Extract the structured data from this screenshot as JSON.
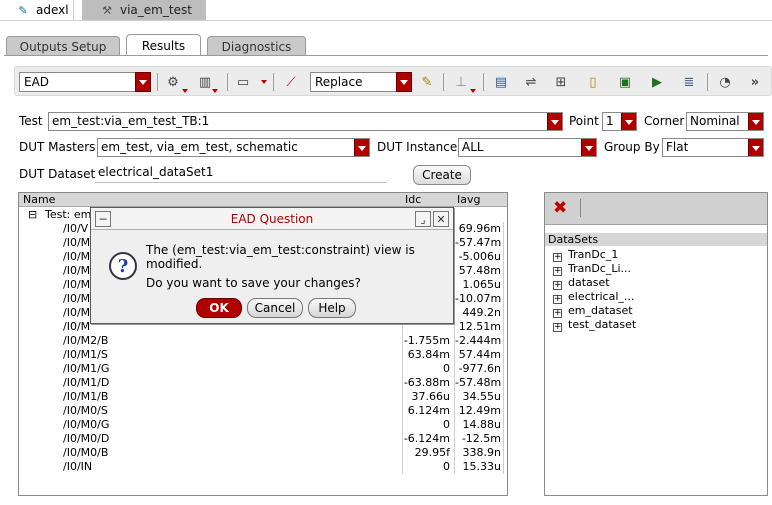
{
  "window_tabs": [
    {
      "label": "adexl",
      "icon": "pencil-icon"
    },
    {
      "label": "via_em_test",
      "icon": "schematic-icon"
    }
  ],
  "sub_tabs": [
    "Outputs Setup",
    "Results",
    "Diagnostics"
  ],
  "toolbar": {
    "view_select": "EAD",
    "mode_select": "Replace"
  },
  "form": {
    "test_label": "Test",
    "test_value": "em_test:via_em_test_TB:1",
    "point_label": "Point",
    "point_value": "1",
    "corner_label": "Corner",
    "corner_value": "Nominal",
    "dut_masters_label": "DUT Masters",
    "dut_masters_value": "em_test, via_em_test, schematic",
    "dut_instance_label": "DUT Instance",
    "dut_instance_value": "ALL",
    "group_by_label": "Group By",
    "group_by_value": "Flat",
    "dut_dataset_label": "DUT Dataset",
    "dut_dataset_value": "electrical_dataSet1",
    "create_button": "Create"
  },
  "table": {
    "headers": [
      "Name",
      "Idc",
      "Iavg"
    ],
    "group_label": "Test: em",
    "group_toggle": "⊟",
    "rows": [
      {
        "name": "/I0/V",
        "idc": "",
        "iavg": "69.96m"
      },
      {
        "name": "/I0/M",
        "idc": "",
        "iavg": "-57.47m"
      },
      {
        "name": "/I0/M",
        "idc": "",
        "iavg": "-5.006u"
      },
      {
        "name": "/I0/M",
        "idc": "",
        "iavg": "57.48m"
      },
      {
        "name": "/I0/M",
        "idc": "",
        "iavg": "1.065u"
      },
      {
        "name": "/I0/M",
        "idc": "",
        "iavg": "-10.07m"
      },
      {
        "name": "/I0/M",
        "idc": "",
        "iavg": "449.2n"
      },
      {
        "name": "/I0/M",
        "idc": "",
        "iavg": "12.51m"
      },
      {
        "name": "/I0/M2/B",
        "idc": "-1.755m",
        "iavg": "-2.444m"
      },
      {
        "name": "/I0/M1/S",
        "idc": "63.84m",
        "iavg": "57.44m"
      },
      {
        "name": "/I0/M1/G",
        "idc": "0",
        "iavg": "-977.6n"
      },
      {
        "name": "/I0/M1/D",
        "idc": "-63.88m",
        "iavg": "-57.48m"
      },
      {
        "name": "/I0/M1/B",
        "idc": "37.66u",
        "iavg": "34.55u"
      },
      {
        "name": "/I0/M0/S",
        "idc": "6.124m",
        "iavg": "12.49m"
      },
      {
        "name": "/I0/M0/G",
        "idc": "0",
        "iavg": "14.88u"
      },
      {
        "name": "/I0/M0/D",
        "idc": "-6.124m",
        "iavg": "-12.5m"
      },
      {
        "name": "/I0/M0/B",
        "idc": "29.95f",
        "iavg": "338.9n"
      },
      {
        "name": "/I0/IN",
        "idc": "0",
        "iavg": "15.33u"
      }
    ]
  },
  "datasets": {
    "header": "DataSets",
    "items": [
      "TranDc_1",
      "TranDc_Li...",
      "dataset",
      "electrical_...",
      "em_dataset",
      "test_dataset"
    ]
  },
  "dialog": {
    "title": "EAD Question",
    "message": "The (em_test:via_em_test:constraint) view is modified.",
    "question": "Do you want to save your changes?",
    "ok": "OK",
    "cancel": "Cancel",
    "help": "Help"
  },
  "colors": {
    "accent": "#b00000",
    "toolbar": "#ececec"
  }
}
